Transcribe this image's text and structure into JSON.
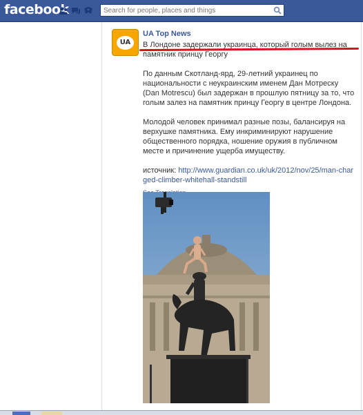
{
  "header": {
    "logo": "facebook",
    "search_placeholder": "Search for people, places and things",
    "jewels": [
      "friend-requests-icon",
      "messages-icon",
      "notifications-icon"
    ]
  },
  "post": {
    "page_name": "UA Top News",
    "avatar_text": "UA",
    "headline": "В Лондоне задержали украинца, который голым вылез на памятник принцу Георгу",
    "paragraph1": "По данным Скотланд-ярд, 29-летний украинец по национальности с неукраинским именем Дан Мотреску (Dan Motrescu) был задержан в прошлую пятницу за то, что голым залез на памятник принцу Георгу в центре Лондона.",
    "paragraph2": "Молодой человек принимал разные позы, балансируя на верхушке памятника. Ему инкриминируют нарушение общественного порядка, ношение оружия в публичном месте и причинение ущерба имуществу.",
    "source_label": "источник: ",
    "source_url": "http://www.guardian.co.uk/uk/2012/nov/25/man-charged-climber-whitehall-standstill",
    "see_translation": "See Translation"
  },
  "colors": {
    "brand": "#3b5998",
    "avatar_bg": "#f7a600",
    "annotation": "#d8121c"
  }
}
